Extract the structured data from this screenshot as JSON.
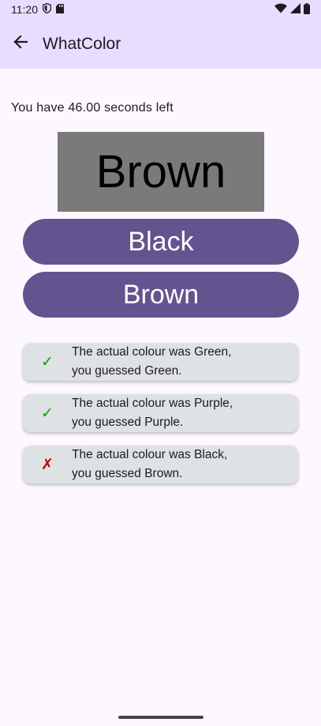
{
  "status": {
    "time": "11:20",
    "left_icons": [
      "shield-icon",
      "sd-card-icon"
    ],
    "right_icons": [
      "wifi-icon",
      "signal-icon",
      "battery-icon"
    ]
  },
  "app_bar": {
    "title": "WhatColor",
    "back_icon": "arrow-back-icon"
  },
  "timer": {
    "text": "You have 46.00 seconds left"
  },
  "prompt": {
    "word": "Brown",
    "background": "#7A7A7A"
  },
  "choices": [
    {
      "label": "Black"
    },
    {
      "label": "Brown"
    }
  ],
  "history": [
    {
      "correct": true,
      "mark": "✓",
      "mark_color": "#0A9E0A",
      "line1": "The actual colour was Green,",
      "line2": "you guessed Green."
    },
    {
      "correct": true,
      "mark": "✓",
      "mark_color": "#0A9E0A",
      "line1": "The actual colour was Purple,",
      "line2": "you guessed Purple."
    },
    {
      "correct": false,
      "mark": "✗",
      "mark_color": "#C00000",
      "line1": "The actual colour was Black,",
      "line2": "you guessed Brown."
    }
  ],
  "colors": {
    "app_bar": "#E9DDFF",
    "button": "#62548F",
    "card": "#DEE2E5",
    "background": "#FDF7FF"
  }
}
